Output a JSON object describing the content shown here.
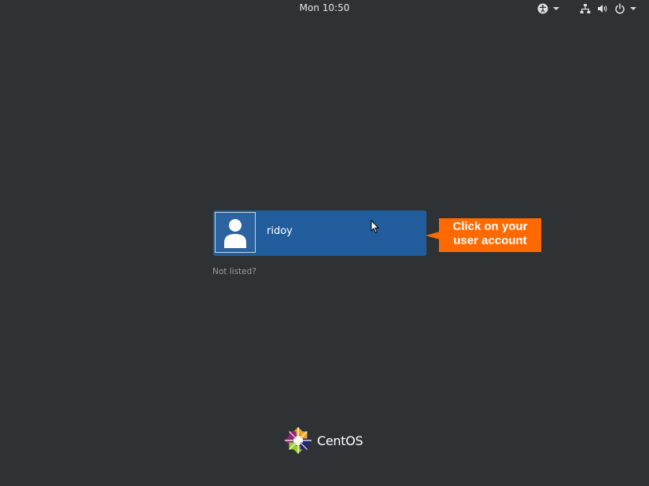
{
  "topbar": {
    "clock": "Mon 10:50",
    "icons": [
      "accessibility-icon",
      "network-icon",
      "volume-icon",
      "power-icon"
    ]
  },
  "login": {
    "username": "ridoy",
    "not_listed": "Not listed?"
  },
  "annotation": {
    "text": "Click on your user account",
    "color": "#ff6a00"
  },
  "brand": {
    "name": "CentOS"
  },
  "colors": {
    "background": "#2e3234",
    "user_card": "#215d9c"
  }
}
